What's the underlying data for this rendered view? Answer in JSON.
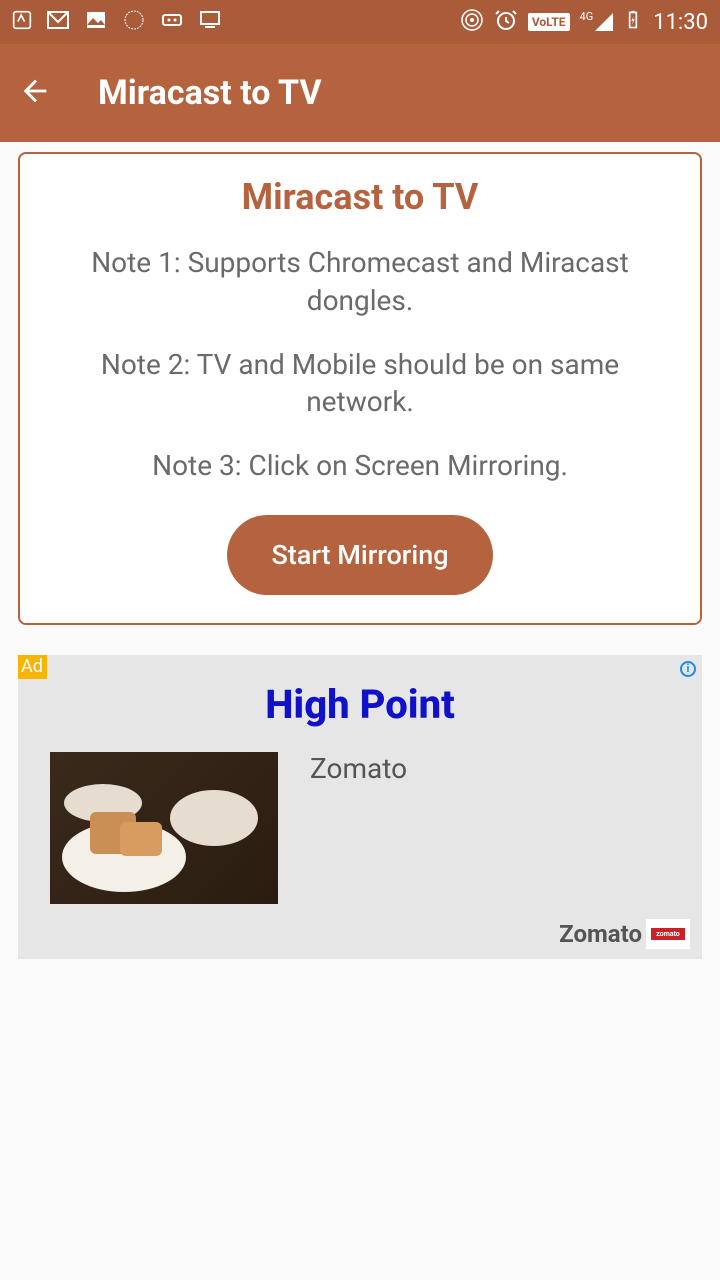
{
  "status_bar": {
    "time": "11:30",
    "volte": "VoLTE",
    "net_label": "4G"
  },
  "toolbar": {
    "title": "Miracast to TV"
  },
  "card": {
    "title": "Miracast to TV",
    "note1": "Note 1: Supports Chromecast and Miracast dongles.",
    "note2": "Note 2: TV and Mobile should be on same network.",
    "note3": "Note 3: Click on Screen Mirroring.",
    "start_button": "Start Mirroring"
  },
  "ad": {
    "badge": "Ad",
    "headline": "High Point",
    "text": "Zomato",
    "brand": "Zomato",
    "logo_text": "zomato"
  }
}
